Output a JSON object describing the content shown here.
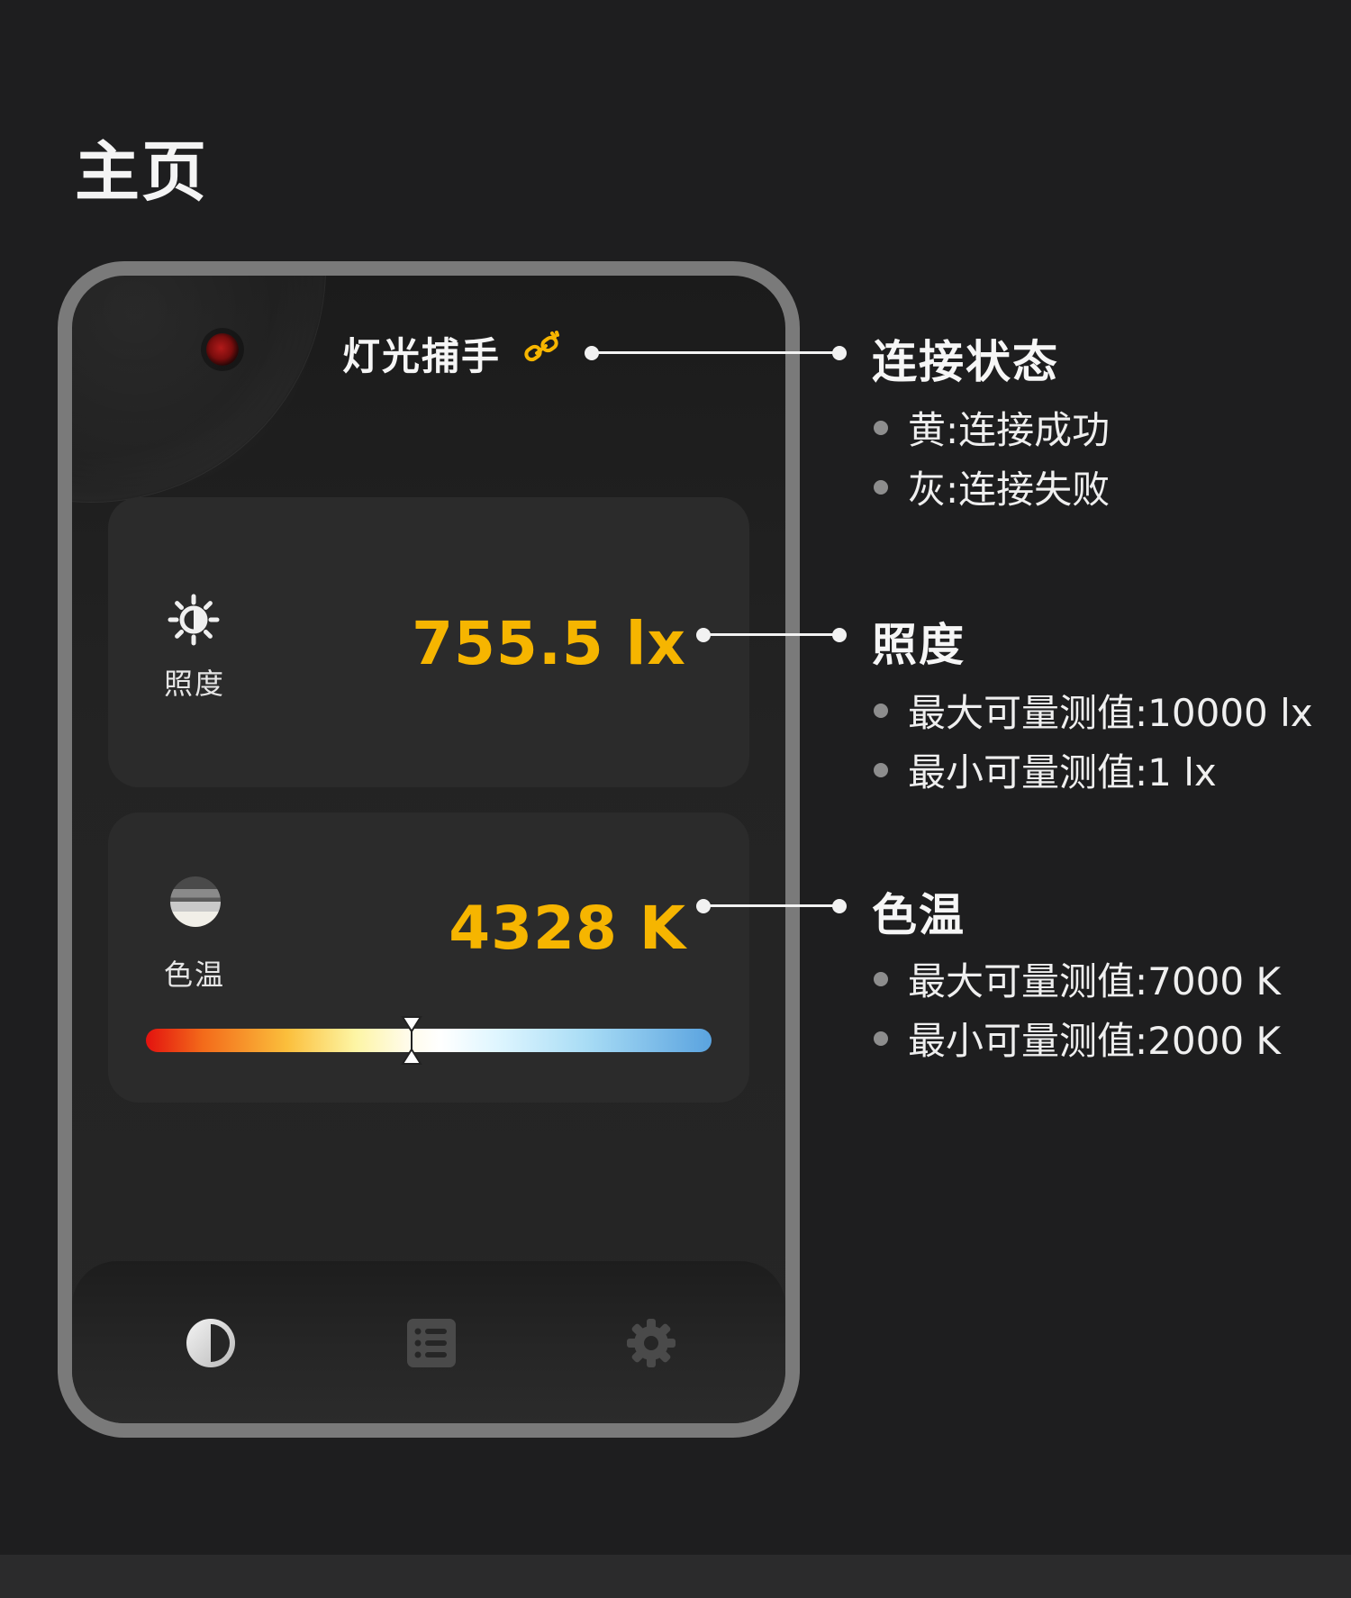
{
  "page": {
    "title": "主页"
  },
  "phone": {
    "app_title": "灯光捕手",
    "connection_icon": "link-icon",
    "connection_color": "#f6b500",
    "lux_card": {
      "label": "照度",
      "value": "755.5 lx",
      "icon": "sun-icon"
    },
    "cct_card": {
      "label": "色温",
      "value": "4328 K",
      "icon": "color-temperature-icon",
      "slider_position_fraction": 0.47
    },
    "nav": [
      {
        "name": "home",
        "icon": "half-circle-icon",
        "active": true
      },
      {
        "name": "list",
        "icon": "list-icon",
        "active": false
      },
      {
        "name": "settings",
        "icon": "gear-icon",
        "active": false
      }
    ]
  },
  "annotations": [
    {
      "heading": "连接状态",
      "bullets": [
        "黄:连接成功",
        "灰:连接失败"
      ]
    },
    {
      "heading": "照度",
      "bullets": [
        "最大可量测值:10000 lx",
        "最小可量测值:1 lx"
      ]
    },
    {
      "heading": "色温",
      "bullets": [
        "最大可量测值:7000 K",
        "最小可量测值:2000 K"
      ]
    }
  ],
  "colors": {
    "accent": "#f6b500",
    "background": "#1e1e1f",
    "card": "#2b2b2b",
    "frame": "#7a7a7a"
  }
}
